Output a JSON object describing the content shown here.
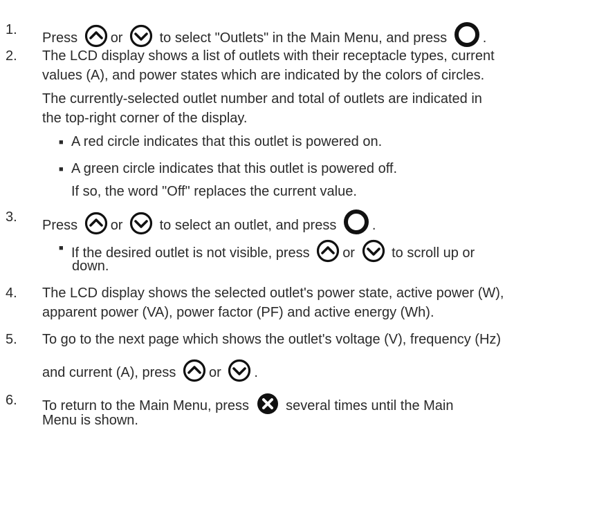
{
  "steps": {
    "s1": {
      "num": "1.",
      "press": "Press",
      "or": "or",
      "text": "to select \"Outlets\" in the Main Menu, and press",
      "end": "."
    },
    "s2": {
      "num": "2.",
      "l1": "The LCD display shows a list of outlets with their receptacle types, current",
      "l2": "values (A), and power states which are indicated by the colors of circles.",
      "l3": "The currently-selected outlet number and total of outlets are indicated in",
      "l4": "the top-right corner of the display.",
      "b1": "A red circle indicates that this outlet is powered on.",
      "b2": "A green circle indicates that this outlet is powered off.",
      "b2b": "If so, the word \"Off\" replaces the current value."
    },
    "s3": {
      "num": "3.",
      "press": "Press",
      "or": "or",
      "text": "to select an outlet, and press",
      "end": ".",
      "b1a": "If the desired outlet is not visible, press",
      "b1or": "or",
      "b1b": "to scroll up or",
      "b1c": "down."
    },
    "s4": {
      "num": "4.",
      "l1": "The LCD display shows the selected outlet's power state, active power (W),",
      "l2": "apparent power (VA), power factor (PF) and active energy (Wh)."
    },
    "s5": {
      "num": "5.",
      "l1": "To go to the next page which shows the outlet's voltage (V), frequency (Hz)",
      "l2": "and current (A), press",
      "or": "or",
      "end": "."
    },
    "s6": {
      "num": "6.",
      "l1": "To return to the Main Menu, press",
      "l1b": "several times until the Main",
      "l2": "Menu is shown."
    }
  },
  "bullet": "■",
  "icons": {
    "up": "up-arrow-icon",
    "down": "down-arrow-icon",
    "ok": "select-button-icon",
    "cancel": "cancel-x-icon"
  }
}
